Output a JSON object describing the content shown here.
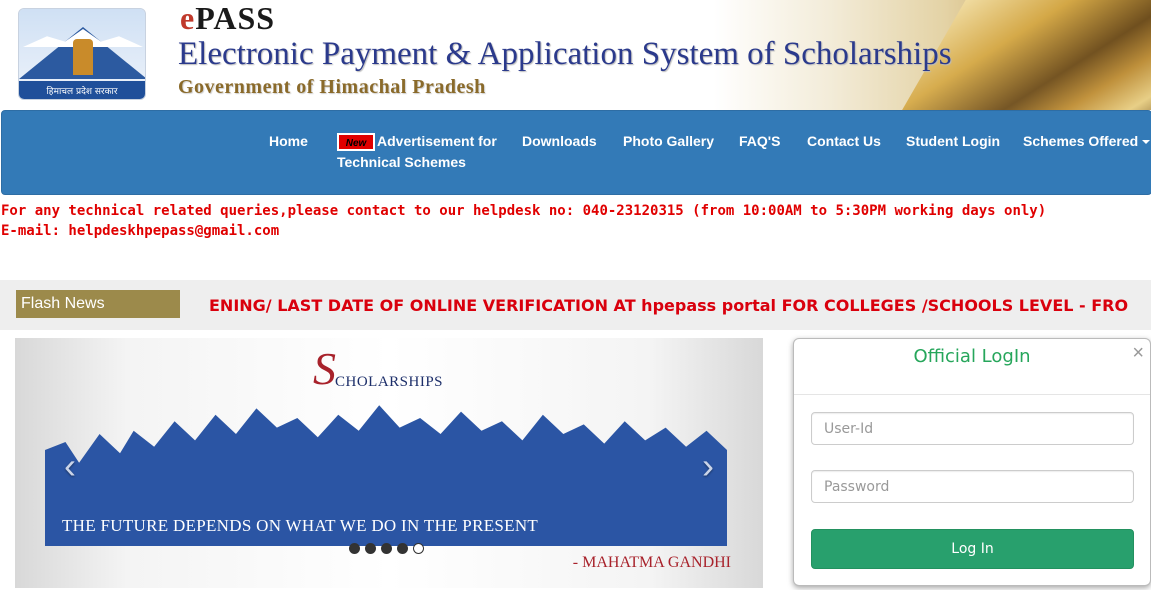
{
  "header": {
    "brand_e": "e",
    "brand_rest": "PASS",
    "title": "Electronic Payment & Application System of Scholarships",
    "subtitle": "Government of Himachal Pradesh",
    "emblem_caption": "हिमाचल प्रदेश सरकार",
    "emblem_icon": "himachal-emblem-icon"
  },
  "nav": {
    "home": "Home",
    "new_badge": "New",
    "advertisement_line1": "Advertisement for",
    "advertisement_line2": "Technical Schemes",
    "downloads": "Downloads",
    "photo_gallery": "Photo Gallery",
    "faqs": "FAQ'S",
    "contact_us": "Contact Us",
    "student_login": "Student Login",
    "schemes_offered": "Schemes Offered",
    "bg_color": "#337ab7"
  },
  "helpdesk": {
    "line1": "For any technical related queries,please contact to our helpdesk no: 040-23120315 (from 10:00AM to 5:30PM working days only)",
    "line2": "E-mail: helpdeskhpepass@gmail.com",
    "color": "#e00000"
  },
  "flash": {
    "label": "Flash News",
    "text": "ENING/ LAST DATE OF ONLINE VERIFICATION AT hpepass portal FOR COLLEGES /SCHOOLS LEVEL - FRO"
  },
  "carousel": {
    "logo_s": "S",
    "logo_text": "CHOLARSHIPS",
    "quote": "THE FUTURE DEPENDS ON WHAT WE DO IN THE PRESENT",
    "author": "- MAHATMA GANDHI",
    "prev_icon": "chevron-left-icon",
    "next_icon": "chevron-right-icon",
    "slide_count": 5,
    "active_slide": 5
  },
  "login": {
    "title": "Official  LogIn",
    "close_label": "×",
    "userid_placeholder": "User-Id",
    "password_placeholder": "Password",
    "button_label": "Log In",
    "accent": "#26a65b",
    "button_color": "#28a06d"
  }
}
